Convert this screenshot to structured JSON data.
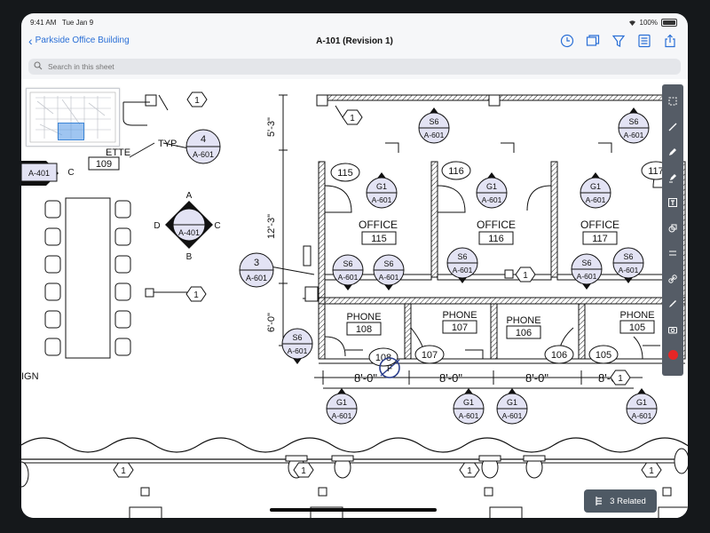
{
  "status_bar": {
    "time": "9:41 AM",
    "date": "Tue Jan 9",
    "battery": "100%"
  },
  "nav": {
    "back_label": "Parkside Office Building",
    "title": "A-101 (Revision 1)",
    "icons": [
      "clock-icon",
      "layers-icon",
      "filter-icon",
      "sheet-list-icon",
      "share-icon"
    ]
  },
  "search": {
    "placeholder": "Search in this sheet"
  },
  "drawing": {
    "rooms": [
      {
        "tag": "115",
        "name": "OFFICE",
        "number": "115"
      },
      {
        "tag": "116",
        "name": "OFFICE",
        "number": "116"
      },
      {
        "tag": "117",
        "name": "OFFICE",
        "number": "117"
      },
      {
        "tag": "108",
        "name": "PHONE",
        "number": "108"
      },
      {
        "tag": "107",
        "name": "PHONE",
        "number": "107"
      },
      {
        "tag": "106",
        "name": "PHONE",
        "number": "106"
      },
      {
        "tag": "105",
        "name": "PHONE",
        "number": "105"
      }
    ],
    "detail_callouts": [
      {
        "num": "4",
        "sheet": "A-601"
      },
      {
        "num": "3",
        "sheet": "A-601"
      }
    ],
    "section_markers": [
      {
        "top": "S6",
        "sheet": "A-601"
      },
      {
        "top": "G1",
        "sheet": "A-601"
      }
    ],
    "elevation_marker": {
      "sheet": "A-401",
      "north": "A",
      "south": "B",
      "east": "C",
      "west": "D"
    },
    "tag_number": "1",
    "left_labels": {
      "typ": "TYP.",
      "ette": "ETTE",
      "number_109": "109",
      "sign": "IGN"
    },
    "dimensions": {
      "top_height": "5'-3\"",
      "office_height": "12'-3\"",
      "phone_height": "6'-0\"",
      "widths": [
        "8'-0\"",
        "8'-0\"",
        "8'-0\"",
        "8'-0\""
      ]
    },
    "fire_tag": "F"
  },
  "toolbar": {
    "tools": [
      "select-icon",
      "line-icon",
      "pen-icon",
      "highlighter-icon",
      "text-icon",
      "shape-icon",
      "ruler-icon",
      "link-icon",
      "pencil-icon",
      "camera-icon",
      "record-icon"
    ]
  },
  "related": {
    "label": "3 Related"
  }
}
